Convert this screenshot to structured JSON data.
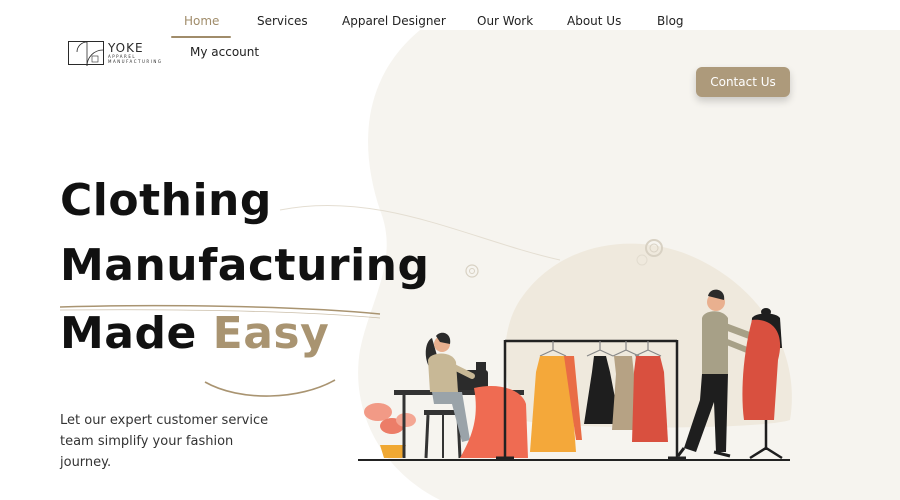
{
  "brand": {
    "name": "YOKE",
    "sub": "APPAREL",
    "tag": "MANUFACTURING"
  },
  "nav": {
    "items": [
      {
        "label": "Home",
        "active": true
      },
      {
        "label": "Services"
      },
      {
        "label": "Apparel Designer"
      },
      {
        "label": "Our Work"
      },
      {
        "label": "About Us"
      },
      {
        "label": "Blog"
      }
    ],
    "account": "My account",
    "contact": "Contact Us"
  },
  "hero": {
    "line1": "Clothing",
    "line2": "Manufacturing",
    "line3_a": "Made",
    "line3_b": "Easy",
    "subtitle": "Let our expert customer service team simplify your fashion journey."
  },
  "colors": {
    "accent": "#a99471",
    "button": "#ad9a7b",
    "blob": "#f6f4ef",
    "dress_orange": "#f4a83a",
    "dress_red": "#d9503f",
    "dress_taupe": "#b6a284"
  }
}
